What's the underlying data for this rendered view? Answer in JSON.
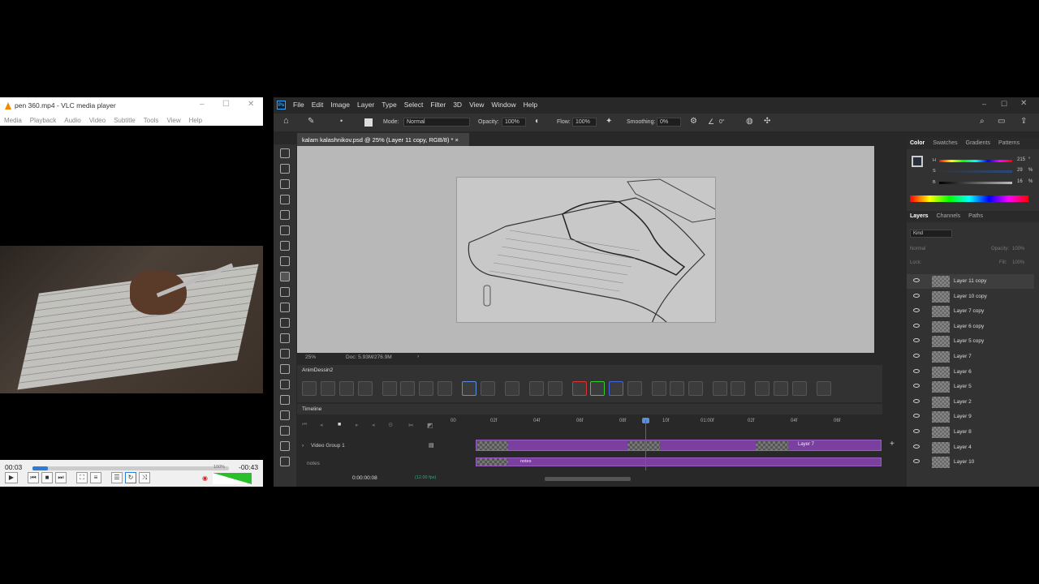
{
  "vlc": {
    "window_title": "pen 360.mp4 - VLC media player",
    "menu": [
      "Media",
      "Playback",
      "Audio",
      "Video",
      "Subtitle",
      "Tools",
      "View",
      "Help"
    ],
    "time_elapsed": "00:03",
    "time_remaining": "-00:43",
    "seek_progress": 0.08,
    "volume_label": "100%",
    "icons": [
      "play-icon",
      "prev-icon",
      "stop-icon",
      "next-icon",
      "fullscreen-icon",
      "extended-settings-icon",
      "playlist-icon",
      "loop-icon",
      "shuffle-icon",
      "mute-icon"
    ]
  },
  "ps": {
    "menu": [
      "File",
      "Edit",
      "Image",
      "Layer",
      "Type",
      "Select",
      "Filter",
      "3D",
      "View",
      "Window",
      "Help"
    ],
    "options": {
      "mode_label": "Mode:",
      "mode_value": "Normal",
      "opacity_label": "Opacity:",
      "opacity_value": "100%",
      "flow_label": "Flow:",
      "flow_value": "100%",
      "smoothing_label": "Smoothing:",
      "smoothing_value": "0%",
      "angle_value": "0°"
    },
    "document_tab": "kalam kalashnikov.psd @ 25% (Layer 11 copy, RGB/8) *",
    "status": {
      "zoom": "25%",
      "doc": "Doc: 5.93M/276.9M"
    },
    "anim_panel_title": "AnimDessin2",
    "timeline": {
      "title": "Timeline",
      "ruler": [
        "00",
        "02f",
        "04f",
        "06f",
        "08f",
        "10f",
        "01:00f",
        "02f",
        "04f",
        "06f"
      ],
      "group_label": "Video Group 1",
      "notes_label": "notes",
      "clip_label": "Layer 7",
      "notes_clip_label": "notes",
      "timecode": "0:00:00:08",
      "fps": "(12.00 fps)"
    },
    "color_panel": {
      "tabs": [
        "Color",
        "Swatches",
        "Gradients",
        "Patterns"
      ],
      "h_label": "H",
      "s_label": "S",
      "b_label": "B",
      "h": "215",
      "s": "29",
      "b": "16",
      "unit_deg": "°",
      "unit_pct": "%"
    },
    "layers_panel": {
      "tabs": [
        "Layers",
        "Channels",
        "Paths"
      ],
      "filter": "Kind",
      "blend": "Normal",
      "opacity_label": "Opacity:",
      "opacity_value": "100%",
      "lock_label": "Lock:",
      "fill_label": "Fill:",
      "fill_value": "100%",
      "layers": [
        "Layer 11 copy",
        "Layer 10 copy",
        "Layer 7 copy",
        "Layer 6 copy",
        "Layer 5 copy",
        "Layer 7",
        "Layer 6",
        "Layer 5",
        "Layer 2",
        "Layer 9",
        "Layer 8",
        "Layer 4",
        "Layer 10"
      ]
    }
  }
}
